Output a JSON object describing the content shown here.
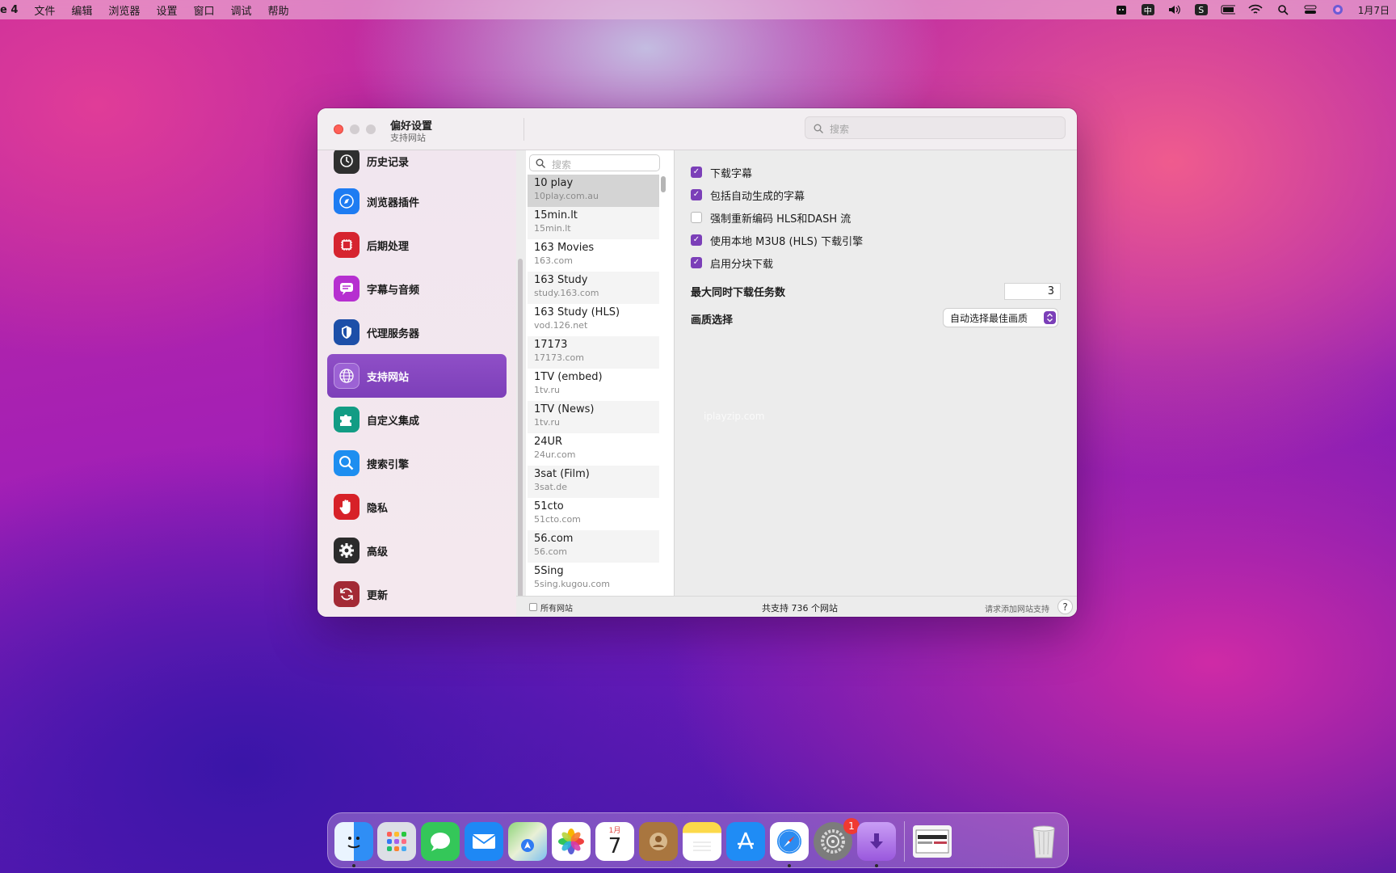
{
  "menubar": {
    "app_name": "e 4",
    "menus": [
      "文件",
      "编辑",
      "浏览器",
      "设置",
      "窗口",
      "调试",
      "帮助"
    ],
    "input_method": "中",
    "date": "1月7日"
  },
  "window": {
    "title": "偏好设置",
    "subtitle": "支持网站",
    "search_placeholder": "搜索"
  },
  "sidebar": {
    "items": [
      {
        "label": "历史记录",
        "icon": "clock-icon",
        "color": "#2f2f2f"
      },
      {
        "label": "浏览器插件",
        "icon": "compass-icon",
        "color": "#1e7cf2"
      },
      {
        "label": "后期处理",
        "icon": "chip-icon",
        "color": "#d6242f"
      },
      {
        "label": "字幕与音频",
        "icon": "subtitle-icon",
        "color": "#b62fd0"
      },
      {
        "label": "代理服务器",
        "icon": "shield-icon",
        "color": "#1d4fa8"
      },
      {
        "label": "支持网站",
        "icon": "globe-icon",
        "color": "#9c62d4"
      },
      {
        "label": "自定义集成",
        "icon": "puzzle-icon",
        "color": "#129c84"
      },
      {
        "label": "搜索引擎",
        "icon": "magnifier-icon",
        "color": "#1d8ef0"
      },
      {
        "label": "隐私",
        "icon": "hand-icon",
        "color": "#d72128"
      },
      {
        "label": "高级",
        "icon": "gear-icon",
        "color": "#2b2b2b"
      },
      {
        "label": "更新",
        "icon": "refresh-icon",
        "color": "#a32a35"
      }
    ],
    "selected": "支持网站"
  },
  "site_list": {
    "search_placeholder": "搜索",
    "sites": [
      {
        "name": "10 play",
        "domain": "10play.com.au"
      },
      {
        "name": "15min.lt",
        "domain": "15min.lt"
      },
      {
        "name": "163 Movies",
        "domain": "163.com"
      },
      {
        "name": "163 Study",
        "domain": "study.163.com"
      },
      {
        "name": "163 Study (HLS)",
        "domain": "vod.126.net"
      },
      {
        "name": "17173",
        "domain": "17173.com"
      },
      {
        "name": "1TV (embed)",
        "domain": "1tv.ru"
      },
      {
        "name": "1TV (News)",
        "domain": "1tv.ru"
      },
      {
        "name": "24UR",
        "domain": "24ur.com"
      },
      {
        "name": "3sat (Film)",
        "domain": "3sat.de"
      },
      {
        "name": "51cto",
        "domain": "51cto.com"
      },
      {
        "name": "56.com",
        "domain": "56.com"
      },
      {
        "name": "5Sing",
        "domain": "5sing.kugou.com"
      }
    ]
  },
  "settings": {
    "checkboxes": [
      {
        "label": "下载字幕",
        "checked": true
      },
      {
        "label": "包括自动生成的字幕",
        "checked": true
      },
      {
        "label": "强制重新编码 HLS和DASH 流",
        "checked": false
      },
      {
        "label": "使用本地 M3U8 (HLS) 下载引擎",
        "checked": true
      },
      {
        "label": "启用分块下载",
        "checked": true
      }
    ],
    "max_tasks_label": "最大同时下载任务数",
    "max_tasks_value": "3",
    "quality_label": "画质选择",
    "quality_value": "自动选择最佳画质",
    "watermark": "iplayzip.com"
  },
  "footer": {
    "all_sites_label": "所有网站",
    "count_text": "共支持 736 个网站",
    "request_text": "请求添加网站支持",
    "help_label": "?"
  },
  "dock": {
    "apps": [
      "finder-icon",
      "launchpad-icon",
      "messages-icon",
      "mail-icon",
      "maps-icon",
      "photos-icon",
      "calendar-icon",
      "contacts-icon",
      "notes-icon",
      "app-store-icon",
      "safari-icon",
      "system-preferences-icon",
      "downie-icon",
      "preview-icon",
      "trash-icon"
    ],
    "calendar_month": "1月",
    "calendar_day": "7",
    "settings_badge": "1"
  }
}
